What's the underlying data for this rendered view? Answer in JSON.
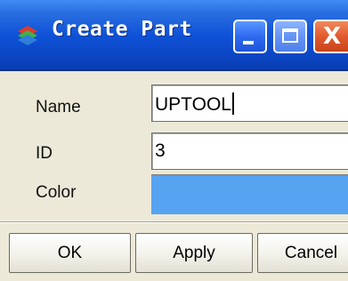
{
  "window": {
    "title": "Create Part"
  },
  "titlebar_icons": {
    "app": "layers-icon",
    "minimize": "minimize-icon",
    "maximize": "maximize-icon",
    "close": "close-icon",
    "close_glyph": "X"
  },
  "form": {
    "name_label": "Name",
    "name_value": "UPTOOL",
    "id_label": "ID",
    "id_value": "3",
    "color_label": "Color",
    "color_value": "#56a3f2"
  },
  "buttons": {
    "ok": "OK",
    "apply": "Apply",
    "cancel": "Cancel"
  }
}
